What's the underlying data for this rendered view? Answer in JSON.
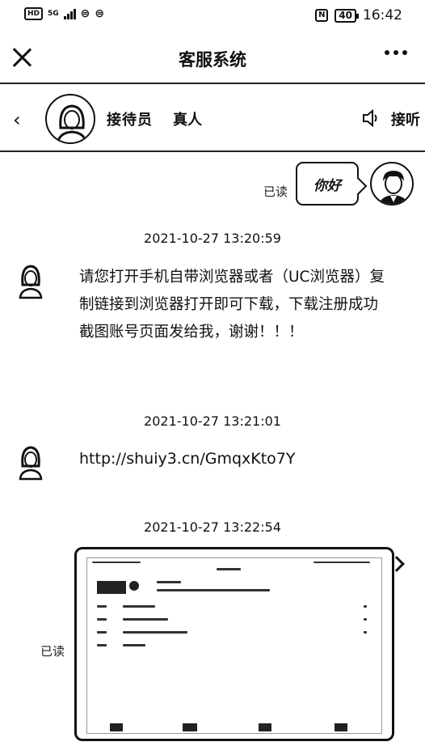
{
  "status_bar": {
    "network": "5G",
    "time": "16:42",
    "battery": "40",
    "nfc": "N"
  },
  "header": {
    "title": "客服系统"
  },
  "agent": {
    "name": "接待员",
    "status": "真人",
    "speaker_label": "接听"
  },
  "messages": {
    "first": {
      "read_label": "已读",
      "text": "你好"
    },
    "t1": "2021-10-27 13:20:59",
    "m1": "请您打开手机自带浏览器或者（UC浏览器）复制链接到浏览器打开即可下载，下载注册成功截图账号页面发给我，谢谢！！！",
    "t2": "2021-10-27 13:21:01",
    "m2": "http://shuiy3.cn/GmqxKto7Y",
    "t3": "2021-10-27 13:22:54",
    "image_read_label": "已读"
  },
  "icons": {
    "close": "close-icon",
    "more": "more-icon",
    "back": "back-icon",
    "speaker": "speaker-icon"
  }
}
